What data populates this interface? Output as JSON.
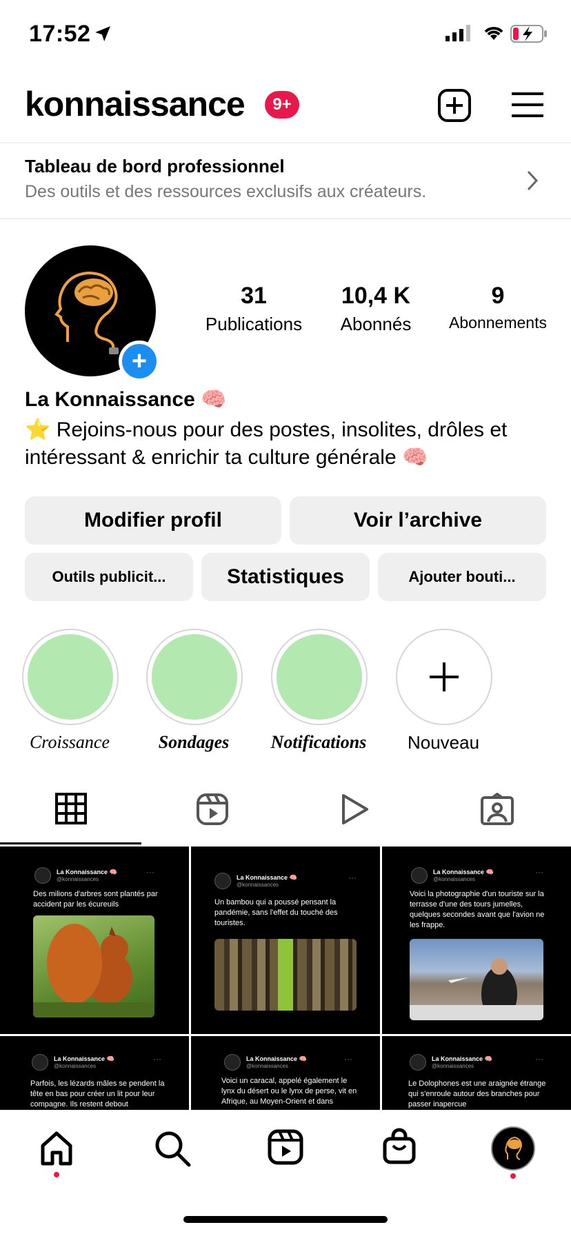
{
  "status_bar": {
    "time": "17:52"
  },
  "header": {
    "username": "konnaissance",
    "notification_badge": "9+"
  },
  "dashboard": {
    "title": "Tableau de bord professionnel",
    "subtitle": "Des outils et des ressources exclusifs aux créateurs."
  },
  "profile": {
    "stats": [
      {
        "value": "31",
        "label": "Publications"
      },
      {
        "value": "10,4 K",
        "label": "Abonnés"
      },
      {
        "value": "9",
        "label": "Abonnements"
      }
    ],
    "display_name": "La Konnaissance 🧠",
    "bio": "⭐ Rejoins-nous pour des postes, insolites, drôles et intéressant & enrichir ta culture générale 🧠"
  },
  "buttons": {
    "edit_profile": "Modifier profil",
    "view_archive": "Voir l’archive",
    "ad_tools": "Outils publicit...",
    "insights": "Statistiques",
    "add_shop": "Ajouter bouti..."
  },
  "highlights": [
    {
      "label": "Croissance"
    },
    {
      "label": "Sondages"
    },
    {
      "label": "Notifications"
    },
    {
      "label": "Nouveau"
    }
  ],
  "posts": [
    {
      "author": "La Konnaissance 🧠",
      "handle": "@konnaissances",
      "text": "Des milions d'arbres sont plantés par accident par les écureuils"
    },
    {
      "author": "La Konnaissance 🧠",
      "handle": "@konnaissances",
      "text": "Un bambou qui a poussé pensant la pandémie, sans l'effet du touché des touristes."
    },
    {
      "author": "La Konnaissance 🧠",
      "handle": "@konnaissances",
      "text": "Voici la photographie d'un touriste sur la terrasse d'une des tours jumelles, quelques secondes avant que l'avion ne les frappe."
    },
    {
      "author": "La Konnaissance 🧠",
      "handle": "@konnaissances",
      "text": "Parfois, les lézards mâles se pendent la tête en bas pour créer un lit pour leur compagne. Ils restent debout"
    },
    {
      "author": "La Konnaissance 🧠",
      "handle": "@konnaissances",
      "text": "Voici un caracal, appelé également le lynx du désert ou le lynx de perse, vit en Afrique, au Moyen-Orient et dans"
    },
    {
      "author": "La Konnaissance 🧠",
      "handle": "@konnaissances",
      "text": "Le Dolophones est une araignée étrange qui s'enroule autour des branches pour passer inapercue"
    }
  ],
  "colors": {
    "badge": "#e8194a",
    "highlight_fill": "#b3e9b0",
    "add_blue": "#1c8ef2"
  }
}
